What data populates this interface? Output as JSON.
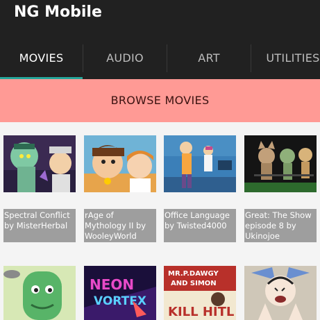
{
  "app": {
    "title": "NG Mobile"
  },
  "tabs": [
    {
      "label": "MOVIES"
    },
    {
      "label": "AUDIO"
    },
    {
      "label": "ART"
    },
    {
      "label": "UTILITIES"
    }
  ],
  "browse": {
    "label": "BROWSE MOVIES"
  },
  "items": [
    {
      "title": "Spectral Conflict by MisterHerbal"
    },
    {
      "title": "rAge of Mythology II by WooleyWorld"
    },
    {
      "title": "Office Language by Twisted4000"
    },
    {
      "title": "Great: The Show episode 8 by Ukinojoe"
    },
    {
      "thumb_text": ""
    },
    {
      "thumb_text": "NEON VORTEX"
    },
    {
      "thumb_text": "MR.P.DAWGY AND SIMON"
    },
    {
      "thumb_text": ""
    }
  ],
  "thumb_texts": {
    "neon": "NEON",
    "vortex": "VORTEX",
    "mrp": "MR.P.DAWGY",
    "simon": "AND SIMON",
    "kill": "KILL HITL"
  },
  "colors": {
    "appbar": "#212121",
    "tab_indicator": "#26a69a",
    "browse_bg": "#ff9a95",
    "caption_bg": "#9e9e9e"
  }
}
